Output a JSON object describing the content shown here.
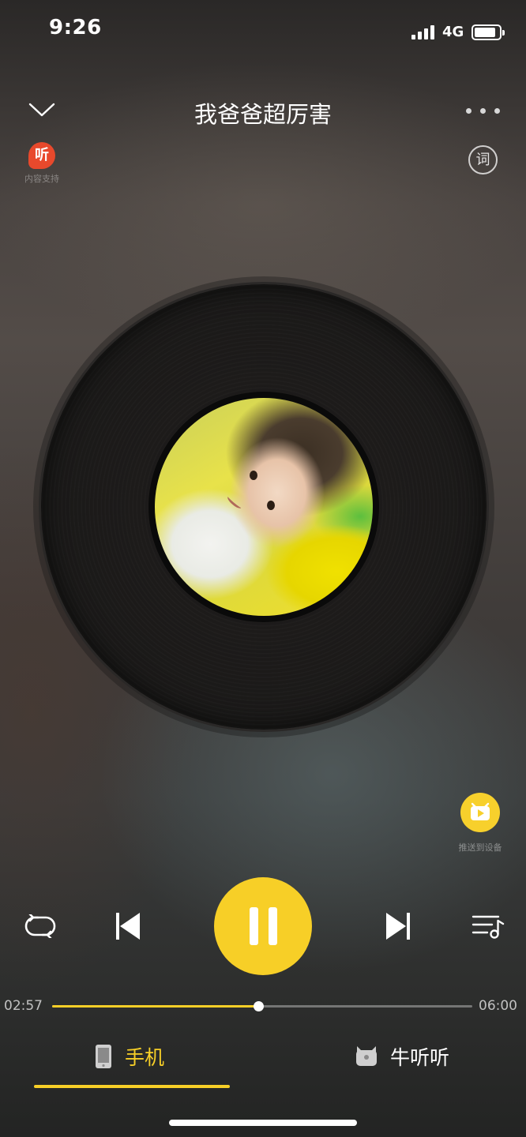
{
  "status_bar": {
    "time": "9:26",
    "network": "4G",
    "battery_icon": "battery-icon",
    "signal_icon": "signal-icon"
  },
  "header": {
    "title": "我爸爸超厉害",
    "collapse_icon": "chevron-down-icon",
    "more_icon": "more-dots-icon"
  },
  "provider": {
    "logo_text": "听",
    "caption": "内容支持"
  },
  "lyrics_button": {
    "label": "词"
  },
  "album_art": {
    "description_icon": "album-cover-image"
  },
  "cast": {
    "label": "推送到设备",
    "icon": "cast-device-icon"
  },
  "controls": {
    "repeat_icon": "repeat-icon",
    "prev_icon": "skip-previous-icon",
    "play_state": "playing",
    "pause_icon": "pause-icon",
    "next_icon": "skip-next-icon",
    "playlist_icon": "playlist-icon"
  },
  "progress": {
    "current": "02:57",
    "total": "06:00",
    "fraction": 0.49
  },
  "output_tabs": [
    {
      "label": "手机",
      "icon": "phone-icon",
      "active": true
    },
    {
      "label": "牛听听",
      "icon": "speaker-device-icon",
      "active": false
    }
  ],
  "colors": {
    "accent": "#f7cf27",
    "provider_red": "#e8492c"
  }
}
